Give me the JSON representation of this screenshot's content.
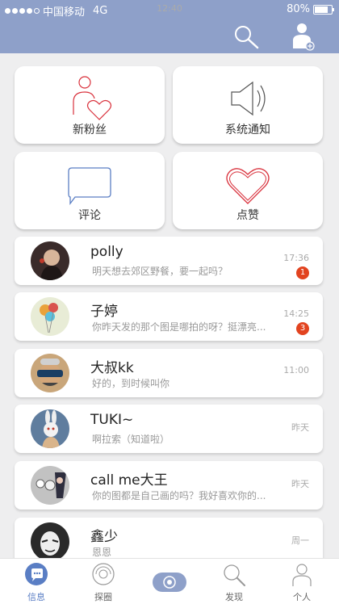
{
  "status_bar": {
    "carrier": "中国移动",
    "network": "4G",
    "time": "12:40",
    "battery": "80%",
    "battery_level": 0.8
  },
  "nav": {
    "search_icon": "search-icon",
    "add_user_icon": "add-user-icon"
  },
  "tiles": [
    {
      "label": "新粉丝",
      "icon": "new-fans-icon"
    },
    {
      "label": "系统通知",
      "icon": "speaker-icon"
    },
    {
      "label": "评论",
      "icon": "comment-icon"
    },
    {
      "label": "点赞",
      "icon": "heart-icon"
    }
  ],
  "messages": [
    {
      "name": "polly",
      "text": "明天想去郊区野餐，要一起吗？",
      "time": "17:36",
      "badge": "1"
    },
    {
      "name": "子婷",
      "text": "你昨天发的那个图是哪拍的呀？挺漂亮...",
      "time": "14:25",
      "badge": "3"
    },
    {
      "name": "大叔kk",
      "text": "好的，到时候叫你",
      "time": "11:00",
      "badge": null
    },
    {
      "name": "TUKI~",
      "text": "啊拉索（知道啦）",
      "time": "昨天",
      "badge": null
    },
    {
      "name": "call me大王",
      "text": "你的图都是自己画的吗？我好喜欢你的...",
      "time": "昨天",
      "badge": null
    },
    {
      "name": "鑫少",
      "text": "恩恩",
      "time": "周一",
      "badge": null
    }
  ],
  "tabs": [
    {
      "label": "信息",
      "icon": "message-icon",
      "active": true
    },
    {
      "label": "探圈",
      "icon": "explore-circle-icon",
      "active": false
    },
    {
      "label": "",
      "icon": "camera-icon",
      "active": false
    },
    {
      "label": "发现",
      "icon": "search-icon",
      "active": false
    },
    {
      "label": "个人",
      "icon": "person-icon",
      "active": false
    }
  ],
  "colors": {
    "header": "#8ea0c9",
    "badge": "#e2431f",
    "accent": "#5a7ec4",
    "heart": "#d9313c"
  }
}
